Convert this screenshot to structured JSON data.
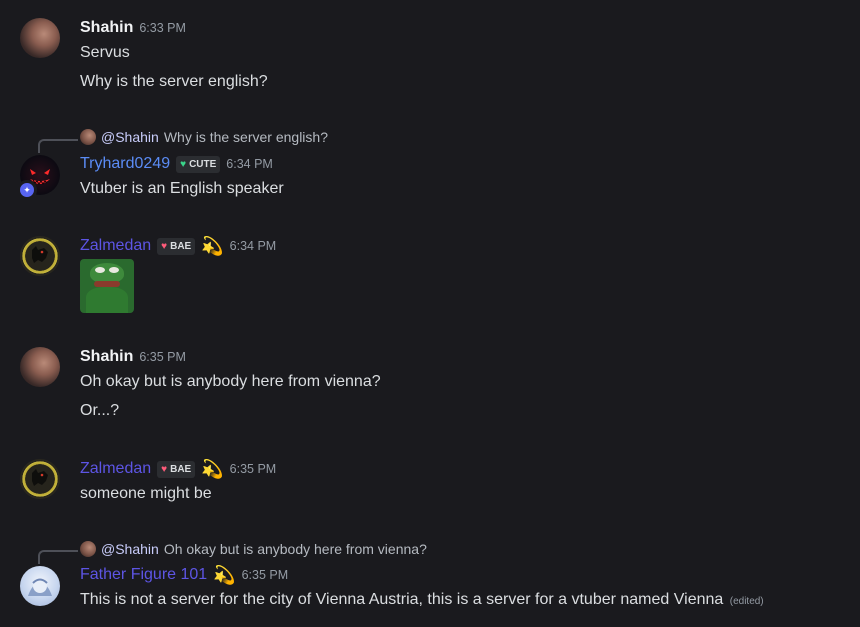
{
  "messages": [
    {
      "user": "Shahin",
      "time": "6:33 PM",
      "lines": [
        "Servus",
        "Why is the server english?"
      ]
    },
    {
      "reply": {
        "mention": "@Shahin",
        "text": "Why is the server english?"
      },
      "user": "Tryhard0249",
      "tag": {
        "icon": "heart-icon",
        "label": "CUTE",
        "heart_color": "#3ad58a"
      },
      "time": "6:34 PM",
      "lines": [
        "Vtuber is an English speaker"
      ]
    },
    {
      "user": "Zalmedan",
      "tag": {
        "icon": "heart-icon",
        "label": "BAE",
        "heart_color": "#ff5b7a"
      },
      "emoji": "💫",
      "time": "6:34 PM",
      "attachment": "pepe-sticker"
    },
    {
      "user": "Shahin",
      "time": "6:35 PM",
      "lines": [
        "Oh okay but is anybody here from vienna?",
        "Or...?"
      ]
    },
    {
      "user": "Zalmedan",
      "tag": {
        "icon": "heart-icon",
        "label": "BAE",
        "heart_color": "#ff5b7a"
      },
      "emoji": "💫",
      "time": "6:35 PM",
      "lines": [
        "someone might be"
      ]
    },
    {
      "reply": {
        "mention": "@Shahin",
        "text": "Oh okay but is anybody here from vienna?"
      },
      "user": "Father Figure 101",
      "emoji": "💫",
      "time": "6:35 PM",
      "lines": [
        "This is not a server for the city of Vienna Austria, this is a server for a vtuber named Vienna"
      ],
      "edited": "(edited)"
    }
  ],
  "colors": {
    "background": "#1a1a1e",
    "tryhard_name": "#5b8cf5",
    "zalmedan_name": "#5d55e4",
    "father_name": "#5d55e4"
  }
}
